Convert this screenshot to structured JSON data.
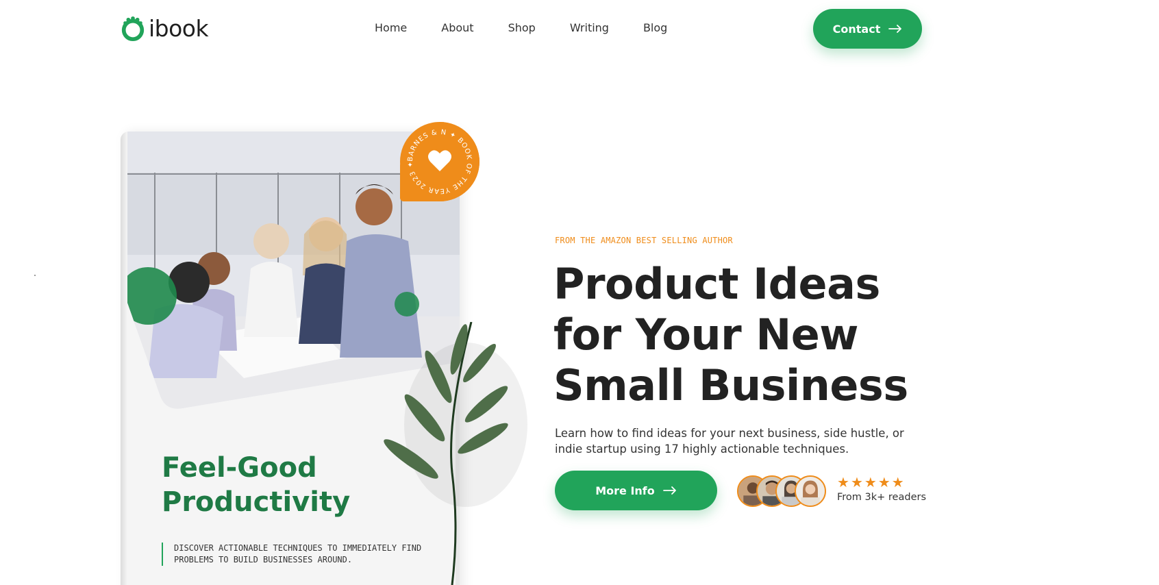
{
  "brand": {
    "name": "ibook",
    "accent": "#21a45a",
    "orange": "#ef8c1a"
  },
  "nav": {
    "items": [
      {
        "label": "Home"
      },
      {
        "label": "About"
      },
      {
        "label": "Shop"
      },
      {
        "label": "Writing"
      },
      {
        "label": "Blog"
      }
    ],
    "contact_label": "Contact"
  },
  "book": {
    "title": "Feel-Good Productivity",
    "subtitle": "DISCOVER ACTIONABLE TECHNIQUES TO IMMEDIATELY FIND PROBLEMS TO BUILD BUSINESSES AROUND.",
    "badge_text": "BARNES & N ✦ BOOK OF THE YEAR 2023 ✦"
  },
  "hero": {
    "eyebrow": "FROM THE AMAZON BEST SELLING AUTHOR",
    "headline": "Product Ideas for Your New Small Business",
    "lede": "Learn how to find ideas for your next business, side hustle, or indie startup using 17 highly actionable techniques.",
    "cta_label": "More Info",
    "rating": {
      "stars": 5,
      "readers_label": "From 3k+ readers"
    },
    "avatar_count": 4
  },
  "icons": {
    "logo": "leaf-ring-icon",
    "arrow": "arrow-right-icon",
    "badge": "heart-icon",
    "star": "star-icon"
  }
}
